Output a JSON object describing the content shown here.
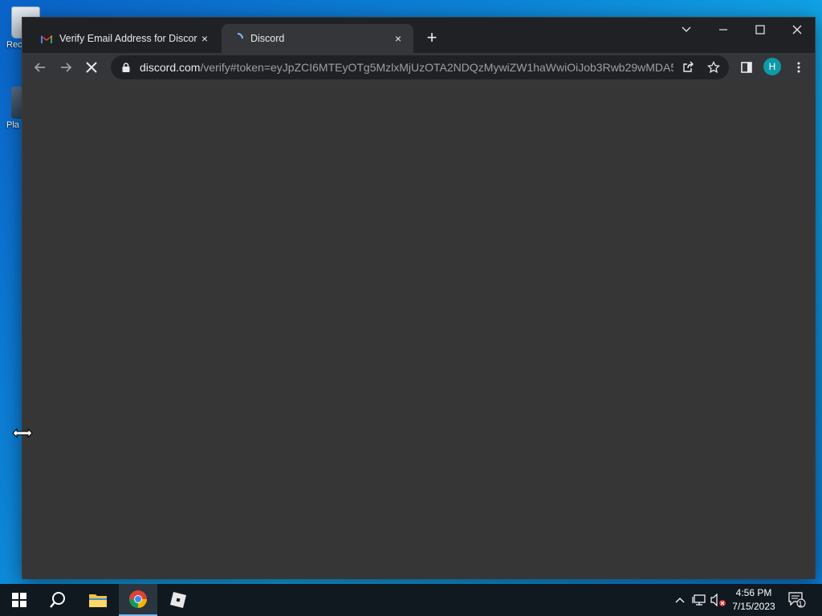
{
  "desktop": {
    "icons": [
      {
        "label": "Rec"
      },
      {
        "label": "Pla"
      }
    ]
  },
  "browser": {
    "tabs": [
      {
        "title": "Verify Email Address for Discord",
        "close": "×"
      },
      {
        "title": "Discord",
        "close": "×"
      }
    ],
    "new_tab_label": "+",
    "address_bar": {
      "host": "discord.com",
      "path": "/verify#token=eyJpZCI6MTEyOTg5MzlxMjUzOTA2NDQzMywiZW1haWwiOiJob3Rwb29wMDA5..."
    },
    "profile_initial": "H",
    "colors": {
      "frame": "#202124",
      "toolbar": "#35363a",
      "content": "#363636",
      "avatar": "#0e9aa7"
    }
  },
  "taskbar": {
    "clock": {
      "time": "4:56 PM",
      "date": "7/15/2023"
    },
    "notification_count": "1"
  }
}
